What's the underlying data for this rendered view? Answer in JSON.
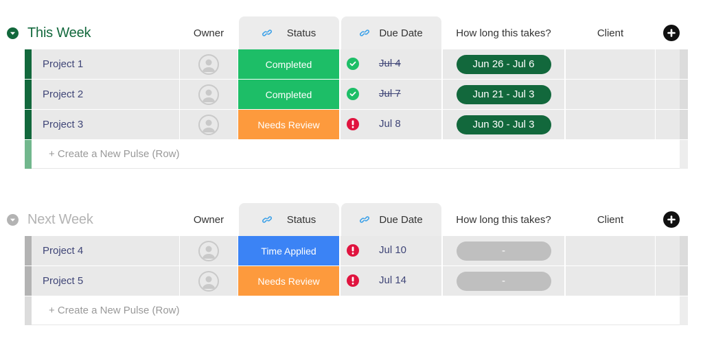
{
  "colors": {
    "this_week_accent": "#12683c",
    "this_week_newrow_strip": "#72b78d",
    "next_week_accent": "#b3b3b3",
    "next_week_newrow_strip": "#dcdcdc",
    "completed": "#1dbe67",
    "needs_review": "#fd9a3d",
    "time_applied": "#3b83f5",
    "done_icon": "#1dbe67",
    "alert_icon": "#e0143f",
    "pill_active": "#12683c",
    "pill_empty": "#bfbfbf",
    "link_icon": "#3aa0e8"
  },
  "columns": {
    "owner": "Owner",
    "status": "Status",
    "due_date": "Due Date",
    "how_long": "How long this takes?",
    "client": "Client"
  },
  "groups": [
    {
      "title": "This Week",
      "collapsed_icon": "chevron-down-icon",
      "new_row_label": "+ Create a New Pulse (Row)",
      "rows": [
        {
          "name": "Project 1",
          "owner": "",
          "status": "Completed",
          "status_key": "completed",
          "due_icon": "check-circle-icon",
          "due_date": "Jul 4",
          "due_done": true,
          "timeline": "Jun 26 - Jul 6",
          "client": ""
        },
        {
          "name": "Project 2",
          "owner": "",
          "status": "Completed",
          "status_key": "completed",
          "due_icon": "check-circle-icon",
          "due_date": "Jul 7",
          "due_done": true,
          "timeline": "Jun 21 - Jul 3",
          "client": ""
        },
        {
          "name": "Project 3",
          "owner": "",
          "status": "Needs Review",
          "status_key": "needs_review",
          "due_icon": "alert-icon",
          "due_date": "Jul 8",
          "due_done": false,
          "timeline": "Jun 30 - Jul 3",
          "client": ""
        }
      ]
    },
    {
      "title": "Next Week",
      "collapsed_icon": "chevron-down-icon",
      "new_row_label": "+ Create a New Pulse (Row)",
      "rows": [
        {
          "name": "Project 4",
          "owner": "",
          "status": "Time Applied",
          "status_key": "time_applied",
          "due_icon": "alert-icon",
          "due_date": "Jul 10",
          "due_done": false,
          "timeline": "-",
          "client": ""
        },
        {
          "name": "Project 5",
          "owner": "",
          "status": "Needs Review",
          "status_key": "needs_review",
          "due_icon": "alert-icon",
          "due_date": "Jul 14",
          "due_done": false,
          "timeline": "-",
          "client": ""
        }
      ]
    }
  ]
}
